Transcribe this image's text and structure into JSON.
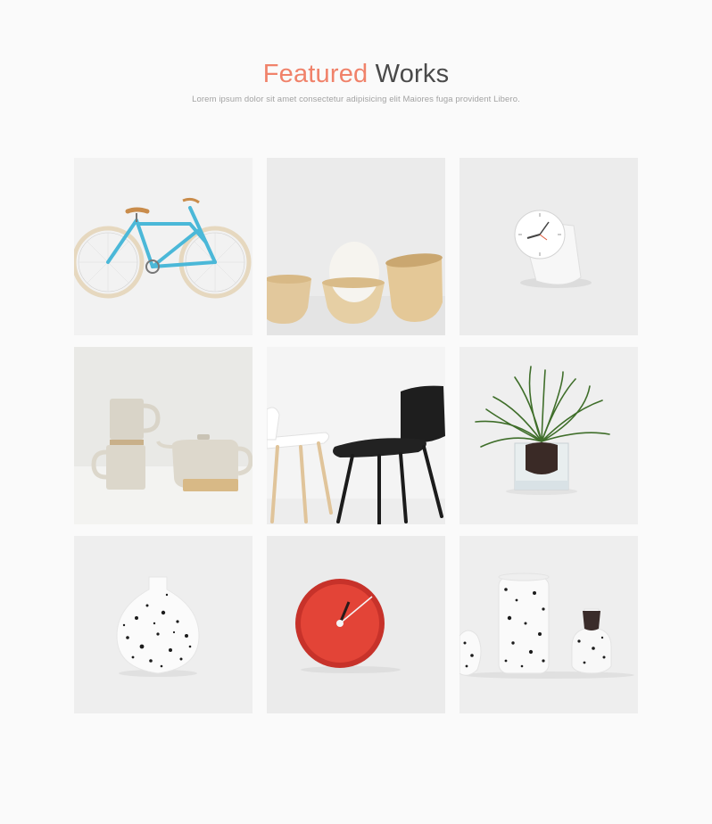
{
  "header": {
    "title_accent": "Featured",
    "title_rest": "Works",
    "subtitle": "Lorem ipsum dolor sit amet consectetur adipisicing elit Maiores fuga provident Libero."
  },
  "colors": {
    "accent": "#f0826a",
    "title_dark": "#4a4a4a",
    "subtitle": "#a3a3a3",
    "page_bg": "#fafafa"
  },
  "works": [
    {
      "id": "bicycle",
      "icon": "bicycle-icon"
    },
    {
      "id": "wooden-cups",
      "icon": "wooden-cups-icon"
    },
    {
      "id": "desk-clock",
      "icon": "desk-clock-icon"
    },
    {
      "id": "ceramic-set",
      "icon": "ceramic-set-icon"
    },
    {
      "id": "chairs",
      "icon": "chairs-icon"
    },
    {
      "id": "potted-plant",
      "icon": "potted-plant-icon"
    },
    {
      "id": "speckled-vase",
      "icon": "speckled-vase-icon"
    },
    {
      "id": "red-clock",
      "icon": "red-clock-icon"
    },
    {
      "id": "speckled-vessels",
      "icon": "speckled-vessels-icon"
    }
  ]
}
